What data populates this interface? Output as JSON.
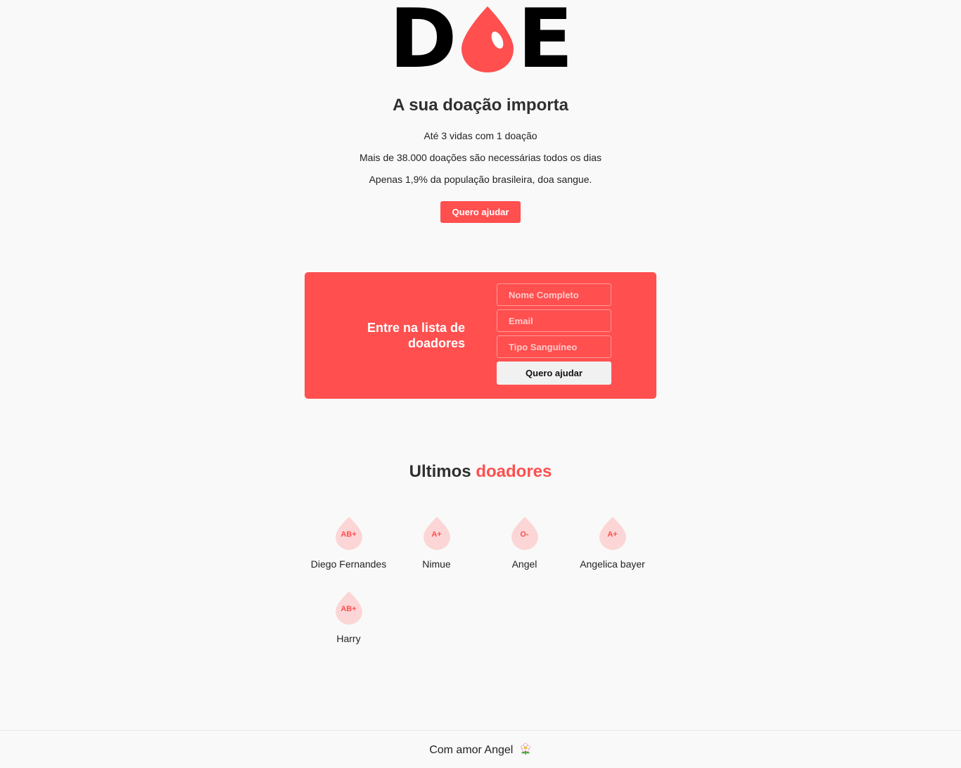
{
  "logo": {
    "left": "D",
    "right": "E",
    "brand_color": "#ff4f4f"
  },
  "intro": {
    "headline": "A sua doação importa",
    "lines": [
      "Até 3 vidas com 1 doação",
      "Mais de 38.000 doações são necessárias todos os dias",
      "Apenas 1,9% da população brasileira, doa sangue."
    ],
    "cta_label": "Quero ajudar"
  },
  "form": {
    "title": "Entre na lista de doadores",
    "name_placeholder": "Nome Completo",
    "email_placeholder": "Email",
    "blood_placeholder": "Tipo Sanguíneo",
    "submit_label": "Quero ajudar"
  },
  "donors": {
    "title_prefix": "Ultimos",
    "title_accent": "doadores",
    "list": [
      {
        "name": "Diego Fernandes",
        "blood": "AB+"
      },
      {
        "name": "Nimue",
        "blood": "A+"
      },
      {
        "name": "Angel",
        "blood": "O-"
      },
      {
        "name": "Angelica bayer",
        "blood": "A+"
      },
      {
        "name": "Harry",
        "blood": "AB+"
      }
    ]
  },
  "footer": {
    "text": "Com amor Angel",
    "icon": "flower-icon"
  }
}
